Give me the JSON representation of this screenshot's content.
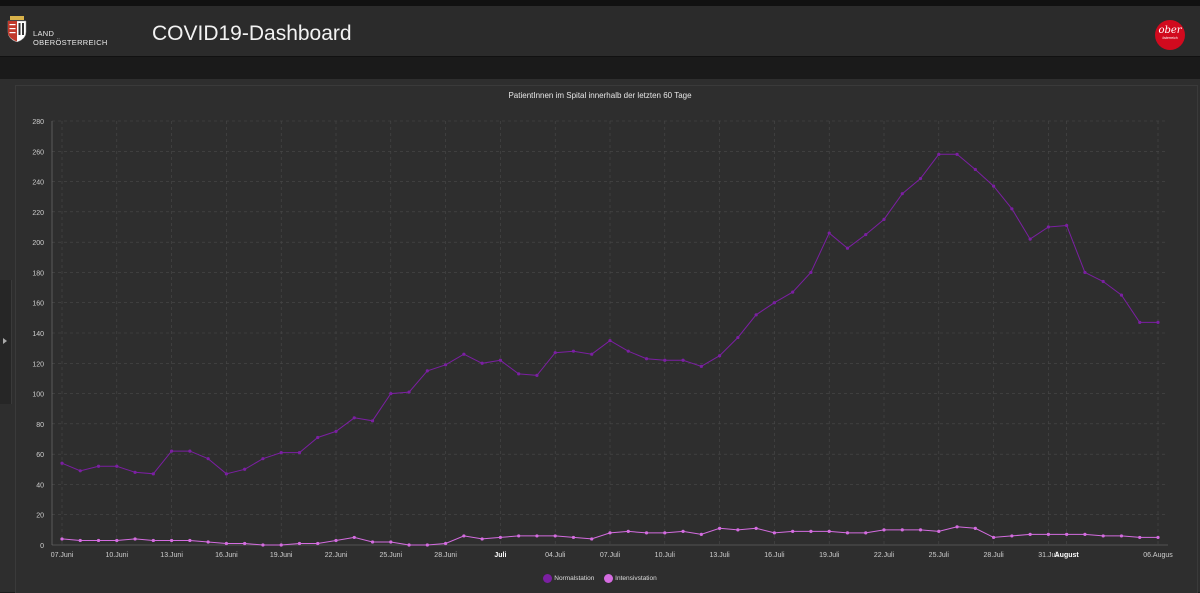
{
  "header": {
    "land_line1": "LAND",
    "land_line2": "OBERÖSTERREICH",
    "title": "COVID19-Dashboard",
    "brand_logo_text": "ober",
    "brand_logo_subtext": "österreich",
    "brand_color": "#d10a1e"
  },
  "icons": {
    "crest": "coat-of-arms-icon",
    "sidebar_toggle": "chevron-right-icon"
  },
  "chart_data": {
    "type": "line",
    "title": "PatientInnen im Spital innerhalb der letzten 60 Tage",
    "xlabel": "",
    "ylabel": "",
    "ylim": [
      0,
      280
    ],
    "yticks": [
      0,
      20,
      40,
      60,
      80,
      100,
      120,
      140,
      160,
      180,
      200,
      220,
      240,
      260,
      280
    ],
    "x": [
      "07.Juni",
      "08.Juni",
      "09.Juni",
      "10.Juni",
      "11.Juni",
      "12.Juni",
      "13.Juni",
      "14.Juni",
      "15.Juni",
      "16.Juni",
      "17.Juni",
      "18.Juni",
      "19.Juni",
      "20.Juni",
      "21.Juni",
      "22.Juni",
      "23.Juni",
      "24.Juni",
      "25.Juni",
      "26.Juni",
      "27.Juni",
      "28.Juni",
      "29.Juni",
      "30.Juni",
      "01.Juli",
      "02.Juli",
      "03.Juli",
      "04.Juli",
      "05.Juli",
      "06.Juli",
      "07.Juli",
      "08.Juli",
      "09.Juli",
      "10.Juli",
      "11.Juli",
      "12.Juli",
      "13.Juli",
      "14.Juli",
      "15.Juli",
      "16.Juli",
      "17.Juli",
      "18.Juli",
      "19.Juli",
      "20.Juli",
      "21.Juli",
      "22.Juli",
      "23.Juli",
      "24.Juli",
      "25.Juli",
      "26.Juli",
      "27.Juli",
      "28.Juli",
      "29.Juli",
      "30.Juli",
      "31.Juli",
      "01.August",
      "02.August",
      "03.August",
      "04.August",
      "05.August",
      "06.August"
    ],
    "tick_labels": [
      "07.Juni",
      "10.Juni",
      "13.Juni",
      "16.Juni",
      "19.Juni",
      "22.Juni",
      "25.Juni",
      "28.Juni",
      "Juli",
      "04.Juli",
      "07.Juli",
      "10.Juli",
      "13.Juli",
      "16.Juli",
      "19.Juli",
      "22.Juli",
      "25.Juli",
      "28.Juli",
      "31.Juli",
      "August",
      "06.August"
    ],
    "tick_display": [
      "07.Juni",
      "10.Juni",
      "13.Juni",
      "16.Juni",
      "19.Juni",
      "22.Juni",
      "25.Juni",
      "28.Juni",
      "Juli",
      "04.Juli",
      "07.Juli",
      "10.Juli",
      "13.Juli",
      "16.Juli",
      "19.Juli",
      "22.Juli",
      "25.Juli",
      "28.Juli",
      "31.Juli",
      "August",
      "06.Augus"
    ],
    "bold_ticks": [
      "Juli",
      "August"
    ],
    "series": [
      {
        "name": "Normalstation",
        "color": "#7b1fa2",
        "values": [
          54,
          49,
          52,
          52,
          48,
          47,
          62,
          62,
          57,
          47,
          50,
          57,
          61,
          61,
          71,
          75,
          84,
          82,
          100,
          101,
          115,
          119,
          126,
          120,
          122,
          113,
          112,
          127,
          128,
          126,
          135,
          128,
          123,
          122,
          122,
          118,
          125,
          137,
          152,
          160,
          167,
          180,
          206,
          196,
          205,
          215,
          232,
          242,
          258,
          258,
          248,
          237,
          222,
          202,
          210,
          211,
          180,
          174,
          165,
          147,
          147
        ]
      },
      {
        "name": "Intensivstation",
        "color": "#d46ce0",
        "values": [
          4,
          3,
          3,
          3,
          4,
          3,
          3,
          3,
          2,
          1,
          1,
          0,
          0,
          1,
          1,
          3,
          5,
          2,
          2,
          0,
          0,
          1,
          6,
          4,
          5,
          6,
          6,
          6,
          5,
          4,
          8,
          9,
          8,
          8,
          9,
          7,
          11,
          10,
          11,
          8,
          9,
          9,
          9,
          8,
          8,
          10,
          10,
          10,
          9,
          12,
          11,
          5,
          6,
          7,
          7,
          7,
          7,
          6,
          6,
          5,
          5
        ]
      }
    ],
    "grid": true,
    "legend_position": "bottom"
  }
}
